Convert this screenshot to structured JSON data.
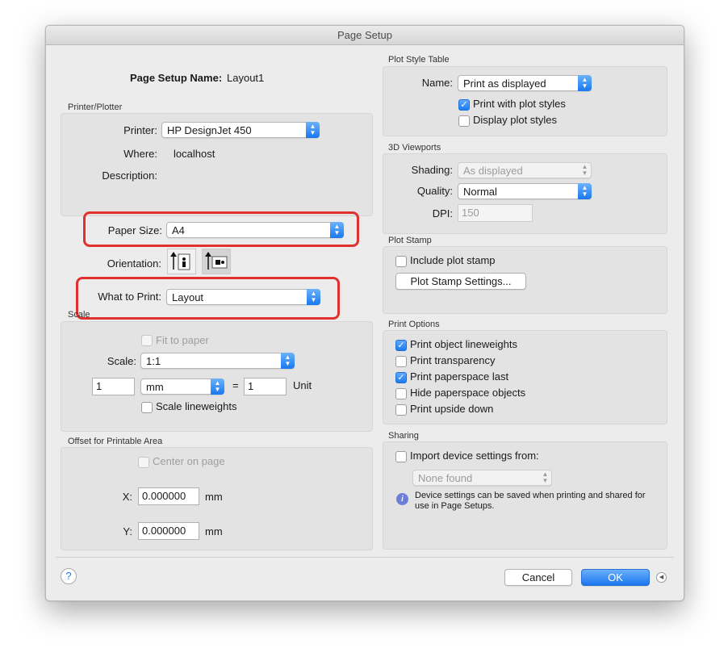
{
  "window": {
    "title": "Page Setup"
  },
  "page_setup": {
    "name_label": "Page Setup Name:",
    "name_value": "Layout1"
  },
  "printer_plotter": {
    "section_title": "Printer/Plotter",
    "printer_label": "Printer:",
    "printer_value": "HP DesignJet 450",
    "where_label": "Where:",
    "where_value": "localhost",
    "description_label": "Description:"
  },
  "paper_size": {
    "label": "Paper Size:",
    "value": "A4"
  },
  "orientation": {
    "label": "Orientation:",
    "selected": "landscape"
  },
  "what_to_print": {
    "label": "What to Print:",
    "value": "Layout"
  },
  "scale": {
    "section_title": "Scale",
    "fit_to_paper": "Fit to paper",
    "scale_label": "Scale:",
    "scale_value": "1:1",
    "amount": "1",
    "units_value": "mm",
    "equals": "=",
    "unit_amount": "1",
    "unit_label": "Unit",
    "scale_lineweights": "Scale lineweights"
  },
  "offset": {
    "section_title": "Offset for Printable Area",
    "center_on_page": "Center on page",
    "x_label": "X:",
    "x_value": "0.000000",
    "y_label": "Y:",
    "y_value": "0.000000",
    "unit": "mm"
  },
  "plot_style_table": {
    "section_title": "Plot Style Table",
    "name_label": "Name:",
    "name_value": "Print as displayed",
    "print_with_plot_styles": "Print with plot styles",
    "display_plot_styles": "Display plot styles"
  },
  "viewports_3d": {
    "section_title": "3D Viewports",
    "shading_label": "Shading:",
    "shading_value": "As displayed",
    "quality_label": "Quality:",
    "quality_value": "Normal",
    "dpi_label": "DPI:",
    "dpi_value": "150"
  },
  "plot_stamp": {
    "section_title": "Plot Stamp",
    "include_plot_stamp": "Include plot stamp",
    "settings_button": "Plot Stamp Settings..."
  },
  "print_options": {
    "section_title": "Print Options",
    "items": [
      {
        "label": "Print object lineweights",
        "checked": true
      },
      {
        "label": "Print transparency",
        "checked": false
      },
      {
        "label": "Print paperspace last",
        "checked": true
      },
      {
        "label": "Hide paperspace objects",
        "checked": false
      },
      {
        "label": "Print upside down",
        "checked": false
      }
    ]
  },
  "sharing": {
    "section_title": "Sharing",
    "import_device_settings": "Import device settings from:",
    "device_value": "None found",
    "info_text": "Device settings can be saved when printing and shared for use in Page Setups."
  },
  "footer": {
    "help": "?",
    "cancel": "Cancel",
    "ok": "OK"
  },
  "colors": {
    "highlight": "#e0312d",
    "accent": "#1d7cf2"
  },
  "icons": {
    "check": "✓",
    "popup_arrows": "⌃⌄",
    "info": "i",
    "disclosure": "◀"
  }
}
